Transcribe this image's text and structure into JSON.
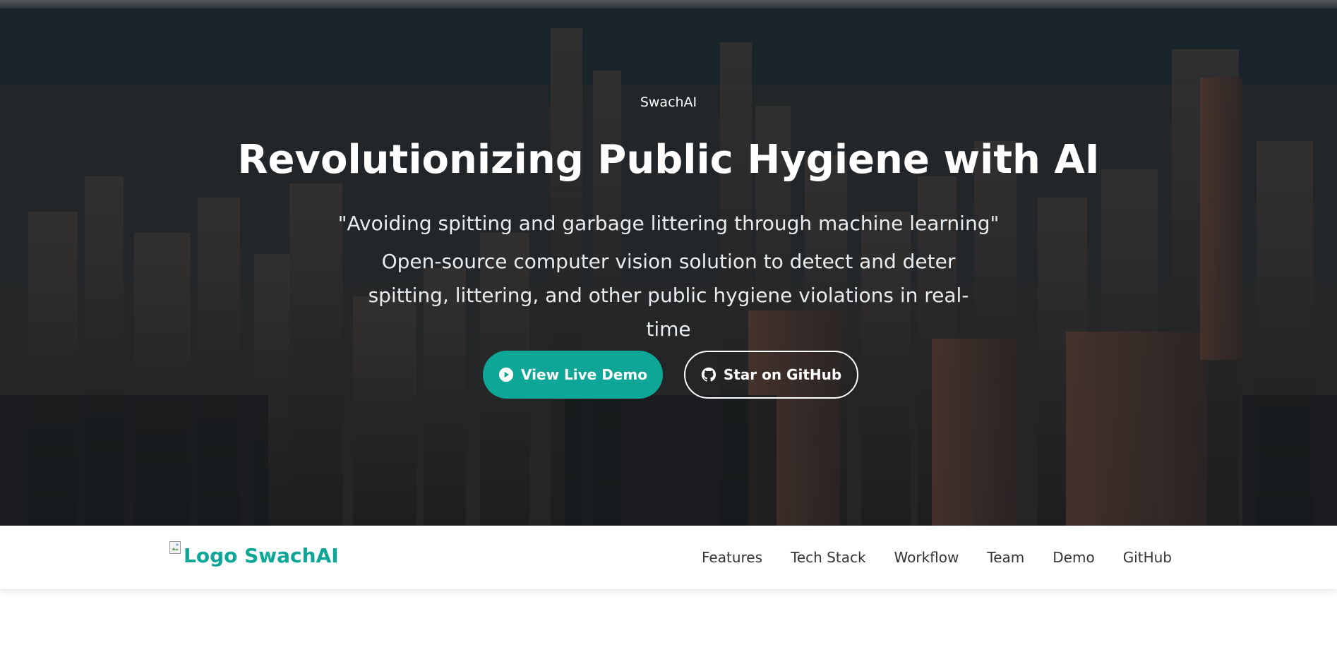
{
  "hero": {
    "brand": "SwachAI",
    "headline": "Revolutionizing Public Hygiene with AI",
    "tagline": "\"Avoiding spitting and garbage littering through machine learning\"",
    "description": "Open-source computer vision solution to detect and deter spitting, littering, and other public hygiene violations in real-time",
    "background": "city-skyline-aerial-photo",
    "buttons": {
      "demo": {
        "label": "View Live Demo",
        "icon": "play-circle-icon"
      },
      "github": {
        "label": "Star on GitHub",
        "icon": "github-icon"
      }
    }
  },
  "navbar": {
    "logo_alt": "Logo",
    "logo_text": "SwachAI",
    "links": [
      "Features",
      "Tech Stack",
      "Workflow",
      "Team",
      "Demo",
      "GitHub"
    ]
  },
  "colors": {
    "accent": "#0ea696",
    "nav_text": "#333333",
    "hero_overlay": "#1d2730"
  }
}
